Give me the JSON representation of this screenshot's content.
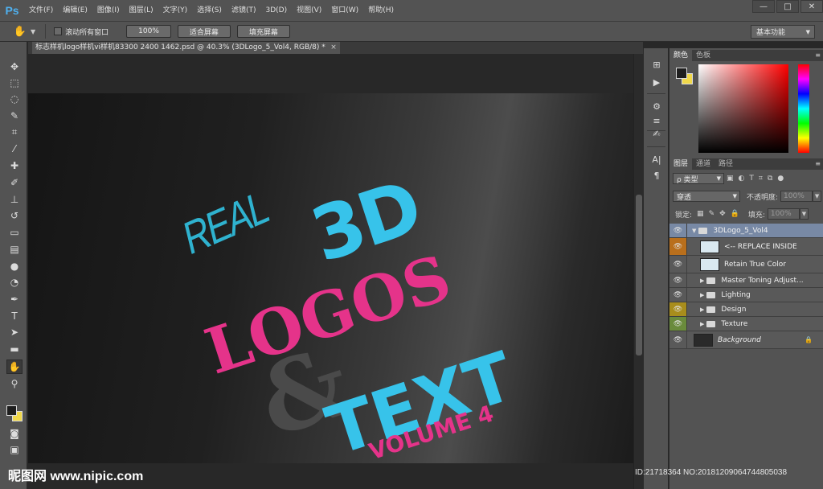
{
  "app": {
    "logo": "Ps"
  },
  "menu": [
    "文件(F)",
    "编辑(E)",
    "图像(I)",
    "图层(L)",
    "文字(Y)",
    "选择(S)",
    "滤镜(T)",
    "3D(D)",
    "视图(V)",
    "窗口(W)",
    "帮助(H)"
  ],
  "window_controls": {
    "minimize": "—",
    "maximize": "□",
    "close": "✕"
  },
  "options": {
    "scroll_all_label": "滚动所有窗口",
    "zoom_100": "100%",
    "fit_screen": "适合屏幕",
    "fill_screen": "填充屏幕",
    "workspace": "基本功能"
  },
  "document": {
    "tab_title": "标志样机logo样机vi样机83300 2400 1462.psd @ 40.3% (3DLogo_5_Vol4, RGB/8) *",
    "close": "×"
  },
  "artwork": {
    "real": "REAL",
    "three_d": "3D",
    "logos": "LOGOS",
    "amp": "&",
    "text": "TEXT",
    "volume": "VOLUME 4"
  },
  "color_panel": {
    "tabs": [
      "颜色",
      "色板"
    ]
  },
  "layers_panel": {
    "tabs": [
      "图层",
      "通道",
      "路径"
    ],
    "filter_kind": "ρ 类型",
    "blend_mode": "穿透",
    "opacity_label": "不透明度:",
    "opacity_value": "100%",
    "lock_label": "锁定:",
    "fill_label": "填充:",
    "fill_value": "100%",
    "layers": [
      {
        "name": "3DLogo_5_Vol4"
      },
      {
        "name": "<-- REPLACE INSIDE"
      },
      {
        "name": "Retain True Color"
      },
      {
        "name": "Master Toning Adjust..."
      },
      {
        "name": "Lighting"
      },
      {
        "name": "Design"
      },
      {
        "name": "Texture"
      },
      {
        "name": "Background"
      }
    ]
  },
  "colors": {
    "accent_cyan": "#37c3ea",
    "accent_pink": "#e5338a",
    "selected_layer": "#7889a5",
    "label_orange": "#b96f1c",
    "label_yellow": "#a88d1c",
    "label_green": "#6a8b3c"
  },
  "watermark": {
    "site": "昵图网 www.nipic.com",
    "id": "ID:21718364 NO:20181209064744805038"
  }
}
